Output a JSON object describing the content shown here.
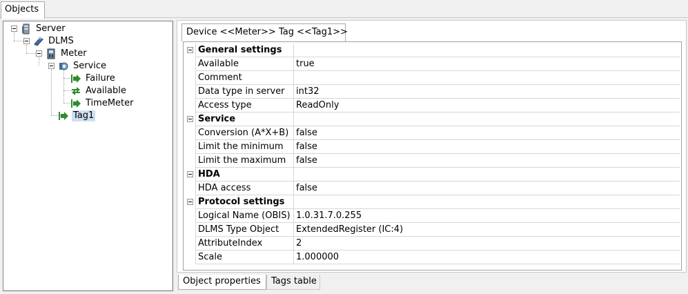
{
  "top_tab": {
    "label": "Objects"
  },
  "tree": {
    "nodes": [
      {
        "label": "Server",
        "icon": "server-icon"
      },
      {
        "label": "DLMS",
        "icon": "dlms-driver-icon"
      },
      {
        "label": "Meter",
        "icon": "meter-device-icon"
      },
      {
        "label": "Service",
        "icon": "service-gear-icon"
      },
      {
        "label": "Failure",
        "icon": "tag-arrow-icon"
      },
      {
        "label": "Available",
        "icon": "tag-bidirectional-icon"
      },
      {
        "label": "TimeMeter",
        "icon": "tag-arrow-icon"
      },
      {
        "label": "Tag1",
        "icon": "tag-arrow-icon"
      }
    ],
    "selected": "Tag1"
  },
  "properties_tab": {
    "label": "Device <<Meter>> Tag <<Tag1>>"
  },
  "properties": {
    "groups": [
      {
        "title": "General settings",
        "rows": [
          {
            "name": "Available",
            "value": "true"
          },
          {
            "name": "Comment",
            "value": ""
          },
          {
            "name": "Data type in server",
            "value": "int32"
          },
          {
            "name": "Access type",
            "value": "ReadOnly"
          }
        ]
      },
      {
        "title": "Service",
        "rows": [
          {
            "name": "Conversion (A*X+B)",
            "value": "false"
          },
          {
            "name": "Limit the minimum",
            "value": "false"
          },
          {
            "name": "Limit the maximum",
            "value": "false"
          }
        ]
      },
      {
        "title": "HDA",
        "rows": [
          {
            "name": "HDA access",
            "value": "false"
          }
        ]
      },
      {
        "title": "Protocol settings",
        "rows": [
          {
            "name": "Logical Name (OBIS)",
            "value": "1.0.31.7.0.255"
          },
          {
            "name": "DLMS Type Object",
            "value": "ExtendedRegister (IC:4)"
          },
          {
            "name": "AttributeIndex",
            "value": "2"
          },
          {
            "name": "Scale",
            "value": "1.000000"
          }
        ]
      }
    ]
  },
  "bottom_tabs": [
    {
      "label": "Object properties",
      "active": true
    },
    {
      "label": "Tags table",
      "active": false
    }
  ],
  "colors": {
    "tag_arrow": "#2e8b2e",
    "selection": "#cde0f1"
  }
}
